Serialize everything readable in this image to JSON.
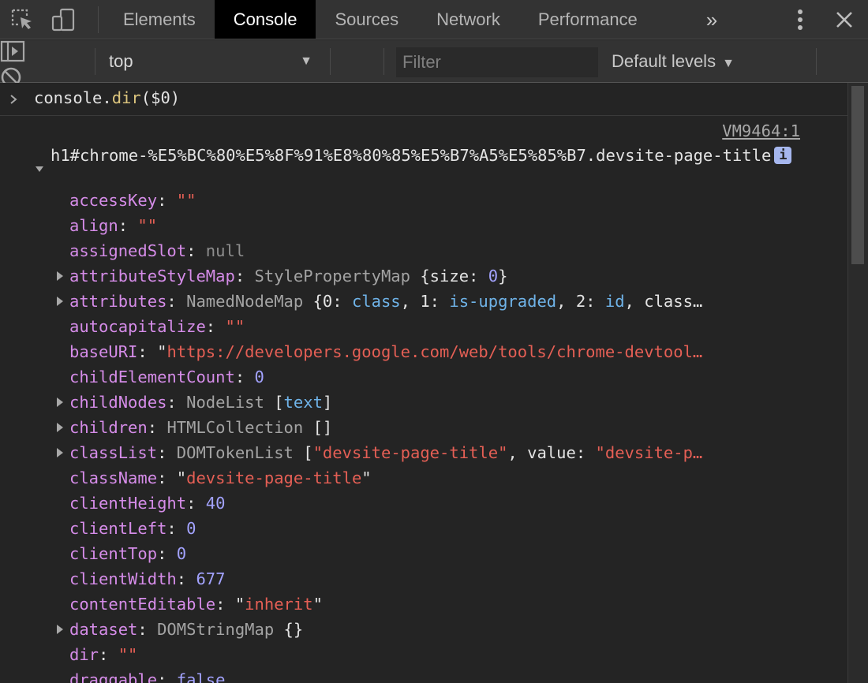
{
  "tabs": [
    "Elements",
    "Console",
    "Sources",
    "Network",
    "Performance"
  ],
  "active_tab": "Console",
  "toolbar": {
    "context": "top",
    "filter_placeholder": "Filter",
    "levels": "Default levels"
  },
  "command": {
    "prompt": ">",
    "object": "console.",
    "method": "dir",
    "args": "($0)"
  },
  "source_link": "VM9464:1",
  "object_header": "h1#chrome-%E5%BC%80%E5%8F%91%E8%80%85%E5%B7%A5%E5%85%B7.devsite-page-title",
  "info_badge": "i",
  "properties": [
    {
      "key": "accessKey",
      "expandable": false,
      "parts": [
        {
          "c": "s",
          "t": "\"\""
        }
      ]
    },
    {
      "key": "align",
      "expandable": false,
      "parts": [
        {
          "c": "s",
          "t": "\"\""
        }
      ]
    },
    {
      "key": "assignedSlot",
      "expandable": false,
      "parts": [
        {
          "c": "null",
          "t": "null"
        }
      ]
    },
    {
      "key": "attributeStyleMap",
      "expandable": true,
      "parts": [
        {
          "c": "t",
          "t": "StylePropertyMap "
        },
        {
          "c": "p",
          "t": "{size: "
        },
        {
          "c": "n",
          "t": "0"
        },
        {
          "c": "p",
          "t": "}"
        }
      ]
    },
    {
      "key": "attributes",
      "expandable": true,
      "parts": [
        {
          "c": "t",
          "t": "NamedNodeMap "
        },
        {
          "c": "p",
          "t": "{0: "
        },
        {
          "c": "blu",
          "t": "class"
        },
        {
          "c": "p",
          "t": ", 1: "
        },
        {
          "c": "blu",
          "t": "is-upgraded"
        },
        {
          "c": "p",
          "t": ", 2: "
        },
        {
          "c": "blu",
          "t": "id"
        },
        {
          "c": "p",
          "t": ", class…"
        }
      ]
    },
    {
      "key": "autocapitalize",
      "expandable": false,
      "parts": [
        {
          "c": "s",
          "t": "\"\""
        }
      ]
    },
    {
      "key": "baseURI",
      "expandable": false,
      "parts": [
        {
          "c": "p",
          "t": "\""
        },
        {
          "c": "s",
          "t": "https://developers.google.com/web/tools/chrome-devtool…"
        }
      ]
    },
    {
      "key": "childElementCount",
      "expandable": false,
      "parts": [
        {
          "c": "n",
          "t": "0"
        }
      ]
    },
    {
      "key": "childNodes",
      "expandable": true,
      "parts": [
        {
          "c": "t",
          "t": "NodeList "
        },
        {
          "c": "p",
          "t": "["
        },
        {
          "c": "blu",
          "t": "text"
        },
        {
          "c": "p",
          "t": "]"
        }
      ]
    },
    {
      "key": "children",
      "expandable": true,
      "parts": [
        {
          "c": "t",
          "t": "HTMLCollection "
        },
        {
          "c": "p",
          "t": "[]"
        }
      ]
    },
    {
      "key": "classList",
      "expandable": true,
      "parts": [
        {
          "c": "t",
          "t": "DOMTokenList "
        },
        {
          "c": "p",
          "t": "["
        },
        {
          "c": "s",
          "t": "\"devsite-page-title\""
        },
        {
          "c": "p",
          "t": ", value: "
        },
        {
          "c": "s",
          "t": "\"devsite-p…"
        }
      ]
    },
    {
      "key": "className",
      "expandable": false,
      "parts": [
        {
          "c": "p",
          "t": "\""
        },
        {
          "c": "s",
          "t": "devsite-page-title"
        },
        {
          "c": "p",
          "t": "\""
        }
      ]
    },
    {
      "key": "clientHeight",
      "expandable": false,
      "parts": [
        {
          "c": "n",
          "t": "40"
        }
      ]
    },
    {
      "key": "clientLeft",
      "expandable": false,
      "parts": [
        {
          "c": "n",
          "t": "0"
        }
      ]
    },
    {
      "key": "clientTop",
      "expandable": false,
      "parts": [
        {
          "c": "n",
          "t": "0"
        }
      ]
    },
    {
      "key": "clientWidth",
      "expandable": false,
      "parts": [
        {
          "c": "n",
          "t": "677"
        }
      ]
    },
    {
      "key": "contentEditable",
      "expandable": false,
      "parts": [
        {
          "c": "p",
          "t": "\""
        },
        {
          "c": "s",
          "t": "inherit"
        },
        {
          "c": "p",
          "t": "\""
        }
      ]
    },
    {
      "key": "dataset",
      "expandable": true,
      "parts": [
        {
          "c": "t",
          "t": "DOMStringMap "
        },
        {
          "c": "p",
          "t": "{}"
        }
      ]
    },
    {
      "key": "dir",
      "expandable": false,
      "parts": [
        {
          "c": "s",
          "t": "\"\""
        }
      ]
    },
    {
      "key": "draggable",
      "expandable": false,
      "parts": [
        {
          "c": "b",
          "t": "false"
        }
      ]
    }
  ]
}
